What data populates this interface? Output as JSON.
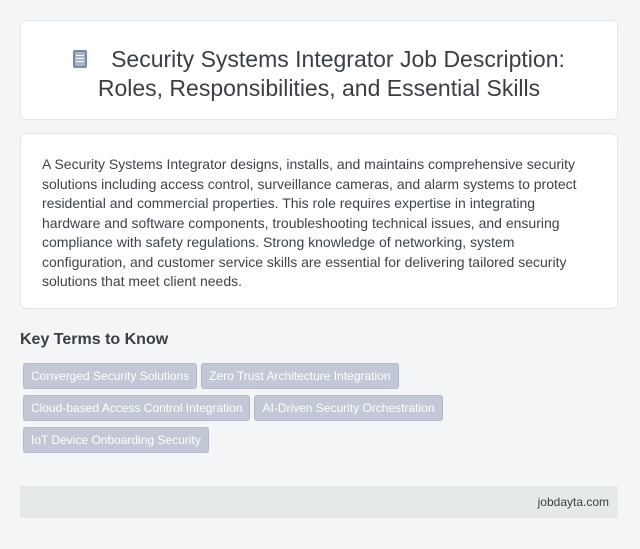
{
  "header": {
    "icon": "document-icon",
    "title_line1": "Security Systems Integrator Job Description:",
    "title_line2": "Roles, Responsibilities, and Essential Skills"
  },
  "description": "A Security Systems Integrator designs, installs, and maintains comprehensive security solutions including access control, surveillance cameras, and alarm systems to protect residential and commercial properties. This role requires expertise in integrating hardware and software components, troubleshooting technical issues, and ensuring compliance with safety regulations. Strong knowledge of networking, system configuration, and customer service skills are essential for delivering tailored security solutions that meet client needs.",
  "key_terms": {
    "heading": "Key Terms to Know",
    "tags": [
      "Converged Security Solutions",
      "Zero Trust Architecture Integration",
      "Cloud-based Access Control Integration",
      "AI-Driven Security Orchestration",
      "IoT Device Onboarding Security"
    ]
  },
  "footer": {
    "site": "jobdayta.com"
  }
}
